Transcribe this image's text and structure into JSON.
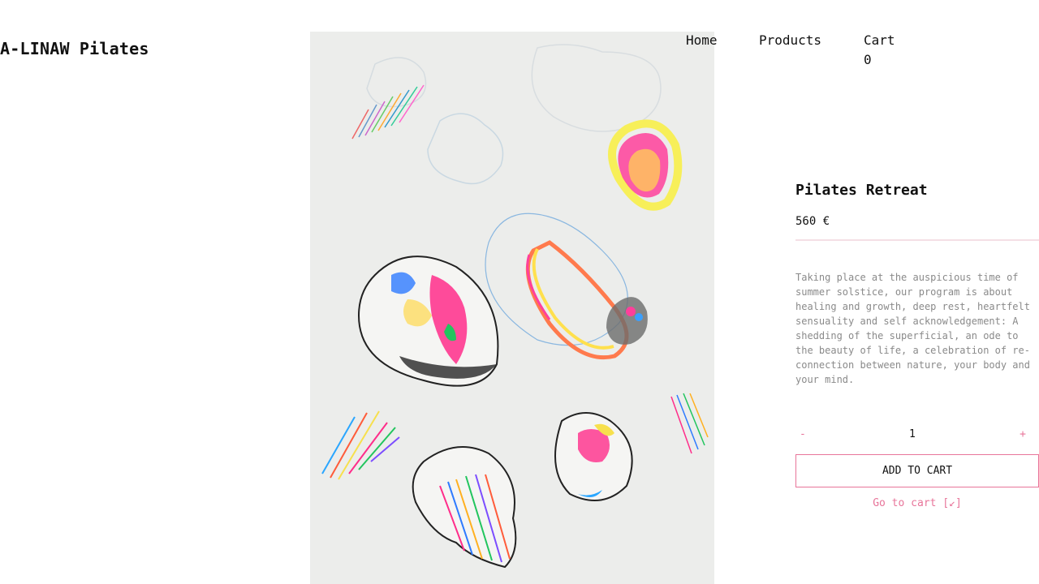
{
  "brand": {
    "name": "A-LINAW Pilates"
  },
  "nav": {
    "home": "Home",
    "products": "Products",
    "cart_label": "Cart",
    "cart_count": "0"
  },
  "product": {
    "title": "Pilates Retreat",
    "price": "560 €",
    "description": "Taking place at the auspicious time of summer solstice, our program is about healing and growth, deep rest, heartfelt sensuality and self acknowledgement: A shedding of the superficial, an ode to the beauty of life, a celebration of re-connection between nature, your body and your mind.",
    "quantity": {
      "minus": "-",
      "value": "1",
      "plus": "+"
    },
    "add_to_cart": "ADD TO CART",
    "go_to_cart": "Go to cart [↙]"
  },
  "colors": {
    "accent": "#e8759a",
    "muted_text": "#8a8a8a",
    "artwork_bg": "#ecedeb"
  }
}
